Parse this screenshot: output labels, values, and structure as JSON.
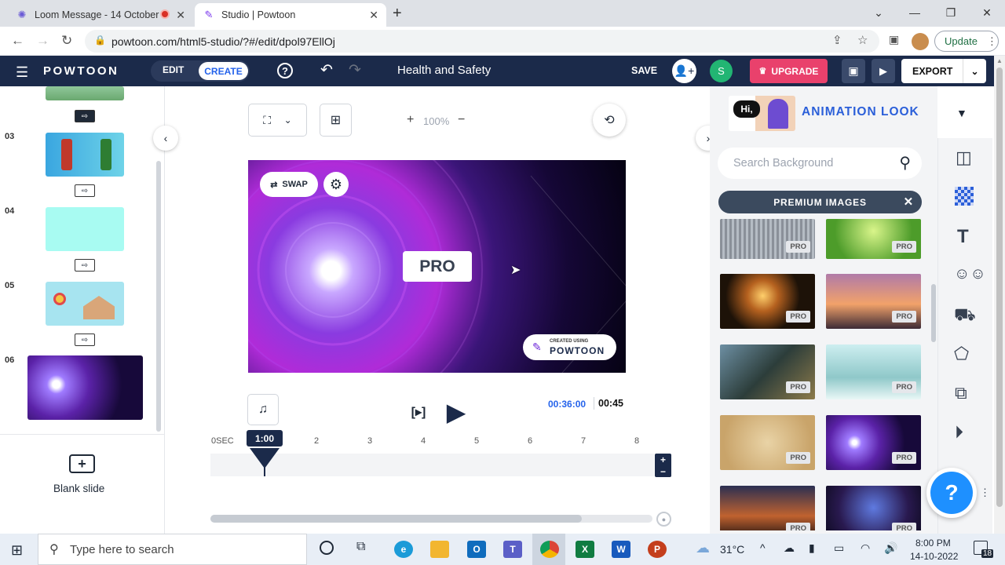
{
  "browser": {
    "tab1_title": "Loom Message - 14 October",
    "tab2_title": "Studio | Powtoon",
    "url": "powtoon.com/html5-studio/?#/edit/dpol97EllOj",
    "update_label": "Update"
  },
  "header": {
    "logo": "POWTOON",
    "edit_label": "EDIT",
    "create_label": "CREATE",
    "project_title": "Health and Safety",
    "save_label": "SAVE",
    "avatar_initial": "S",
    "upgrade_label": "UPGRADE",
    "export_label": "EXPORT"
  },
  "slides": {
    "numbers": [
      "03",
      "04",
      "05",
      "06"
    ],
    "blank_label": "Blank slide"
  },
  "canvas": {
    "zoom": "100%",
    "swap_label": "SWAP",
    "pro_label": "PRO",
    "watermark_small": "CREATED USING",
    "watermark_logo": "POWTOON"
  },
  "playback": {
    "current_time": "00:36:00",
    "total_time": "00:45",
    "playhead_label": "1:00",
    "ticks": [
      "0SEC",
      "2",
      "3",
      "4",
      "5",
      "6",
      "7",
      "8"
    ],
    "scroll_fraction": 0.84
  },
  "rightpanel": {
    "section_title": "ANIMATION LOOK",
    "search_placeholder": "Search Background",
    "filter_chip": "PREMIUM IMAGES",
    "pro_badge": "PRO",
    "images": [
      "grey-stripes",
      "green-bokeh",
      "hand-light",
      "sunset-person",
      "tech-scene",
      "snowy-trees",
      "parchment",
      "purple-space",
      "silhouette-sunset",
      "galaxy"
    ]
  },
  "help_label": "?",
  "taskbar": {
    "search_placeholder": "Type here to search",
    "weather": "31°C",
    "time": "8:00 PM",
    "date": "14-10-2022",
    "notif_count": "18"
  },
  "colors": {
    "header_bg": "#1b2a4a",
    "accent": "#2563eb",
    "upgrade": "#e9416c",
    "avatar": "#22b573"
  }
}
